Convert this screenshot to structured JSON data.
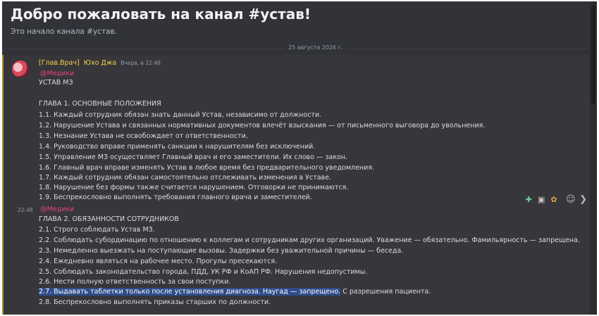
{
  "channel": {
    "title": "Добро пожаловать на канал #устав!",
    "subtitle": "Это начало канала #устав."
  },
  "divider": {
    "date": "25 августа 2026 г."
  },
  "message": {
    "role": "[Глав.Врач]",
    "author": "Юхо Джа",
    "timestamp": "Вчера, в 22:48",
    "mention": "@Медики",
    "title": "УСТАВ МЗ",
    "chapter1": {
      "heading": "ГЛАВА 1. ОСНОВНЫЕ ПОЛОЖЕНИЯ",
      "items": [
        "1.1. Каждый сотрудник обязан знать данный Устав, независимо от должности.",
        "1.2. Нарушение Устава и связанных нормативных документов влечёт взыскания — от письменного выговора до увольнения.",
        "1.3. Незнание Устава не освобождает от ответственности.",
        "1.4. Руководство вправе применять санкции к нарушителям без исключений.",
        "1.5. Управление МЗ осуществляет Главный врач и его заместители. Их слово — закон.",
        "1.6. Главный врач вправе изменять Устав в любое время без предварительного уведомления.",
        "1.7. Каждый сотрудник обязан самостоятельно отслеживать изменения в Уставе.",
        "1.8. Нарушение без формы также считается нарушением. Отговорки не принимаются.",
        "1.9. Беспрекословно выполнять требования главного врача и заместителей."
      ]
    }
  },
  "message2": {
    "short_time": "22:48",
    "mention": "@Медики",
    "chapter2": {
      "heading": "ГЛАВА 2. ОБЯЗАННОСТИ СОТРУДНИКОВ",
      "items": [
        "2.1. Строго соблюдать Устав МЗ.",
        "2.2. Соблюдать субординацию по отношению к коллегам и сотрудникам других организаций. Уважение — обязательно. Фамильярность — запрещена.",
        "2.3. Немедленно выезжать на поступающие вызовы. Задержки без уважительной причины — беседа.",
        "2.4. Ежедневно являться на рабочее место. Прогулы пресекаются.",
        "2.5. Соблюдать законодательство города, ПДД, УК РФ и КоАП РФ. Нарушения недопустимы.",
        "2.6. Нести полную ответственность за свои поступки."
      ],
      "item_27_selected": "2.7. Выдавать таблетки только после установления диагноза. Наугад — запрещено.",
      "item_27_rest": " С разрешения пациента.",
      "item_28": "2.8. Беспрекословно выполнять приказы старших по должности."
    }
  },
  "toolbar": {
    "icons": [
      "reaction-sticker-1",
      "reaction-sticker-2",
      "reaction-sticker-3",
      "add-reaction",
      "more-options"
    ]
  }
}
